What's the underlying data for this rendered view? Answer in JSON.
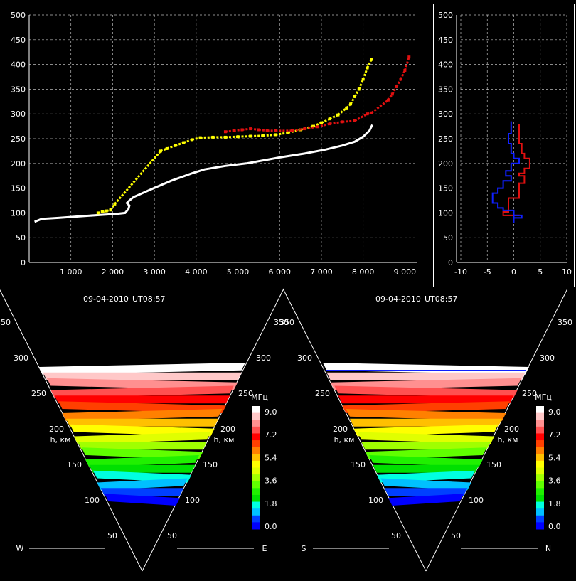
{
  "colors": {
    "background": "#000000",
    "frame": "#ffffff",
    "grid": "#bbbbbb",
    "white_trace": "#ffffff",
    "yellow_trace": "#ffff00",
    "red_trace": "#e01010",
    "blue_trace": "#1020ff",
    "colorbar": [
      "#0000ff",
      "#0040ff",
      "#00c0ff",
      "#00ffe0",
      "#00e000",
      "#20f000",
      "#60ff00",
      "#a0ff00",
      "#e0ff00",
      "#ffff00",
      "#ffc000",
      "#ff8000",
      "#ff4000",
      "#ff0000",
      "#ff5050",
      "#ff9090",
      "#ffc8c8",
      "#ffffff"
    ]
  },
  "chart_data": [
    {
      "type": "scatter",
      "title": "",
      "xlabel": "",
      "ylabel": "",
      "xlim": [
        0,
        9300
      ],
      "ylim": [
        0,
        500
      ],
      "xticks": [
        "1 000",
        "2 000",
        "3 000",
        "4 000",
        "5 000",
        "6 000",
        "7 000",
        "8 000",
        "9 000"
      ],
      "xtick_values": [
        1000,
        2000,
        3000,
        4000,
        5000,
        6000,
        7000,
        8000,
        9000
      ],
      "yticks": [
        "0",
        "50",
        "100",
        "150",
        "200",
        "250",
        "300",
        "350",
        "400",
        "450",
        "500"
      ],
      "ytick_values": [
        0,
        50,
        100,
        150,
        200,
        250,
        300,
        350,
        400,
        450,
        500
      ],
      "grid": true,
      "series": [
        {
          "color": "white",
          "kind": "line",
          "x": [
            130,
            300,
            700,
            1200,
            1700,
            2100,
            2300,
            2380,
            2400,
            2340,
            2400,
            2500,
            2900,
            3400,
            3900,
            4200,
            4700,
            5200,
            6000,
            6600,
            7100,
            7500,
            7800,
            8000,
            8150,
            8220
          ],
          "y": [
            82,
            88,
            90,
            93,
            96,
            98,
            100,
            108,
            115,
            120,
            125,
            132,
            147,
            165,
            180,
            188,
            195,
            200,
            212,
            220,
            228,
            236,
            244,
            254,
            266,
            278
          ]
        },
        {
          "color": "yellow",
          "kind": "dots",
          "x": [
            1650,
            1750,
            1850,
            1950,
            2050,
            3150,
            3300,
            3500,
            3700,
            3900,
            4100,
            4400,
            4700,
            5000,
            5300,
            5600,
            5900,
            6200,
            6500,
            6800,
            7000,
            7200,
            7400,
            7600,
            7700,
            7800,
            7900,
            8000,
            8100,
            8200
          ],
          "y": [
            100,
            102,
            104,
            106,
            118,
            225,
            230,
            236,
            242,
            248,
            252,
            253,
            253,
            254,
            255,
            256,
            258,
            262,
            268,
            275,
            282,
            290,
            298,
            312,
            320,
            335,
            350,
            370,
            393,
            410
          ]
        },
        {
          "color": "red",
          "kind": "dots",
          "x": [
            4700,
            4900,
            5100,
            5300,
            5500,
            5700,
            5900,
            6300,
            6600,
            6900,
            7200,
            7500,
            7800,
            8100,
            8200,
            8600,
            8700,
            8800,
            8900,
            9000,
            9100
          ],
          "y": [
            264,
            266,
            268,
            270,
            268,
            266,
            266,
            266,
            270,
            274,
            280,
            284,
            286,
            300,
            302,
            328,
            340,
            355,
            370,
            388,
            415
          ]
        }
      ]
    },
    {
      "type": "line",
      "title": "",
      "xlim": [
        -10,
        10
      ],
      "ylim": [
        0,
        500
      ],
      "xticks": [
        "-10",
        "-5",
        "0",
        "5",
        "10"
      ],
      "xtick_values": [
        -10,
        -5,
        0,
        5,
        10
      ],
      "yticks": [
        "0",
        "50",
        "100",
        "150",
        "200",
        "250",
        "300",
        "350",
        "400",
        "450",
        "500"
      ],
      "ytick_values": [
        0,
        50,
        100,
        150,
        200,
        250,
        300,
        350,
        400,
        450,
        500
      ],
      "grid": true,
      "series": [
        {
          "color": "red",
          "x": [
            1,
            1,
            1,
            1.5,
            2,
            3,
            3,
            2,
            1,
            2,
            2,
            1,
            1,
            -1,
            -1,
            -1,
            -2,
            -2,
            1,
            1
          ],
          "y": [
            280,
            260,
            240,
            220,
            210,
            200,
            190,
            180,
            175,
            170,
            160,
            150,
            130,
            120,
            110,
            102,
            98,
            95,
            95,
            94
          ]
        },
        {
          "color": "blue",
          "x": [
            -0.5,
            -0.5,
            -1,
            -0.5,
            0,
            1,
            -0.5,
            -1.5,
            -0.5,
            -2,
            -2,
            -3,
            -4,
            -4,
            -3,
            -2,
            0,
            0,
            1.5,
            0
          ],
          "y": [
            285,
            260,
            240,
            220,
            210,
            200,
            185,
            175,
            165,
            155,
            150,
            140,
            130,
            120,
            110,
            105,
            100,
            90,
            95,
            80
          ]
        }
      ]
    },
    {
      "type": "heatmap",
      "header": "09-04-2010",
      "time": "UT08:57",
      "axis_left": "W",
      "axis_right": "E",
      "h_label": "h, км",
      "h_ticks": [
        "50",
        "100",
        "150",
        "200",
        "250",
        "300",
        "350"
      ],
      "h_tick_values": [
        50,
        100,
        150,
        200,
        250,
        300,
        350
      ],
      "top_height": 290,
      "bottom_height": 95,
      "colorbar_unit": "МГц",
      "colorbar_ticks": [
        "9.0",
        "7.2",
        "5.4",
        "3.6",
        "1.8",
        "0.0"
      ]
    },
    {
      "type": "heatmap",
      "header": "09-04-2010",
      "time": "UT08:57",
      "axis_left": "S",
      "axis_right": "N",
      "h_label": "h, км",
      "h_ticks": [
        "50",
        "100",
        "150",
        "200",
        "250",
        "300",
        "350"
      ],
      "h_tick_values": [
        50,
        100,
        150,
        200,
        250,
        300,
        350
      ],
      "top_height": 290,
      "bottom_height": 95,
      "colorbar_unit": "МГц",
      "colorbar_ticks": [
        "9.0",
        "7.2",
        "5.4",
        "3.6",
        "1.8",
        "0.0"
      ]
    }
  ]
}
